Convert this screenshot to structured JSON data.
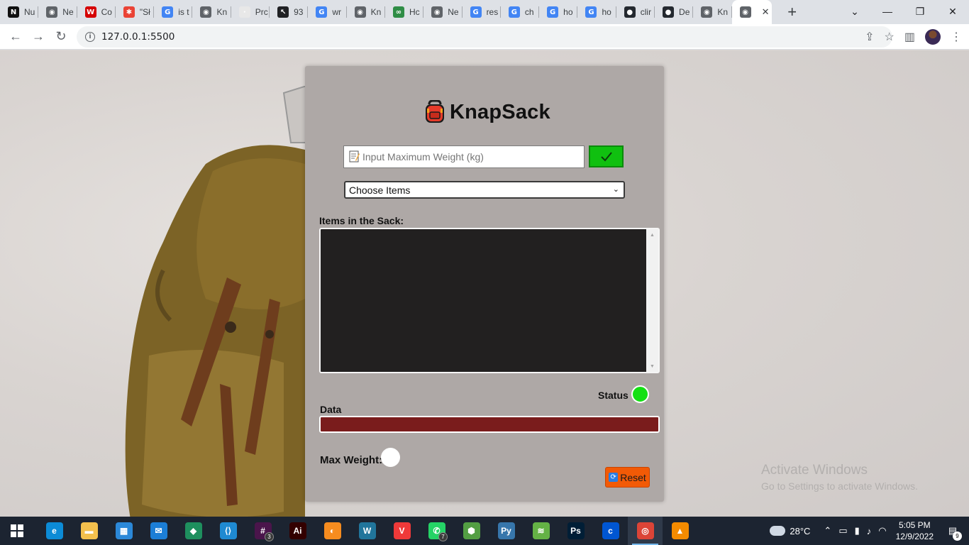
{
  "browser": {
    "tabs": [
      {
        "title": "Nu",
        "icon": "nu-favicon",
        "color": "#111111",
        "glyph": "N"
      },
      {
        "title": "Ne",
        "icon": "chromium-favicon",
        "color": "#5f6368",
        "glyph": "◉"
      },
      {
        "title": "Co",
        "icon": "w3-favicon",
        "color": "#d50000",
        "glyph": "W"
      },
      {
        "title": "\"Sł",
        "icon": "asterisk-favicon",
        "color": "#ea4335",
        "glyph": "✱"
      },
      {
        "title": "is t",
        "icon": "google-favicon",
        "color": "#4285f4",
        "glyph": "G"
      },
      {
        "title": "Kn",
        "icon": "globe-favicon",
        "color": "#5f6368",
        "glyph": "◉"
      },
      {
        "title": "Prc",
        "icon": "doc-favicon",
        "color": "#e8e8e8",
        "glyph": "·"
      },
      {
        "title": "93",
        "icon": "cursor-favicon",
        "color": "#202124",
        "glyph": "↖"
      },
      {
        "title": "wr",
        "icon": "google-favicon",
        "color": "#4285f4",
        "glyph": "G"
      },
      {
        "title": "Kn",
        "icon": "globe-favicon",
        "color": "#5f6368",
        "glyph": "◉"
      },
      {
        "title": "Hc",
        "icon": "gfg-favicon",
        "color": "#2f8d46",
        "glyph": "∞"
      },
      {
        "title": "Ne",
        "icon": "chromium-favicon",
        "color": "#5f6368",
        "glyph": "◉"
      },
      {
        "title": "res",
        "icon": "google-favicon",
        "color": "#4285f4",
        "glyph": "G"
      },
      {
        "title": "ch",
        "icon": "google-favicon",
        "color": "#4285f4",
        "glyph": "G"
      },
      {
        "title": "ho",
        "icon": "google-favicon",
        "color": "#4285f4",
        "glyph": "G"
      },
      {
        "title": "ho",
        "icon": "google-favicon",
        "color": "#4285f4",
        "glyph": "G"
      },
      {
        "title": "clir",
        "icon": "github-favicon",
        "color": "#24292f",
        "glyph": "●"
      },
      {
        "title": "De",
        "icon": "github-favicon",
        "color": "#24292f",
        "glyph": "●"
      },
      {
        "title": "Kn",
        "icon": "globe-favicon",
        "color": "#5f6368",
        "glyph": "◉"
      }
    ],
    "active_tab_icon": "globe-favicon",
    "url": "127.0.0.1:5500"
  },
  "app": {
    "title": "KnapSack",
    "weight_placeholder": "Input Maximum Weight (kg)",
    "select_label": "Choose Items",
    "sack_label": "Items in the Sack:",
    "status_label": "Status",
    "status_color": "#14e014",
    "data_label": "Data",
    "data_bar_color": "#7a1c1c",
    "max_weight_label": "Max Weight:",
    "reset_label": "Reset"
  },
  "watermark": {
    "line1": "Activate Windows",
    "line2": "Go to Settings to activate Windows."
  },
  "taskbar": {
    "apps": [
      {
        "name": "edge",
        "color": "#0c8bd6",
        "glyph": "e"
      },
      {
        "name": "file-explorer",
        "color": "#f3c04d",
        "glyph": "▬"
      },
      {
        "name": "microsoft-store",
        "color": "#2b88d8",
        "glyph": "▦"
      },
      {
        "name": "mail",
        "color": "#1c7ed6",
        "glyph": "✉"
      },
      {
        "name": "gitkraken",
        "color": "#1e8f5e",
        "glyph": "◆"
      },
      {
        "name": "vscode",
        "color": "#1f8ad2",
        "glyph": "⟨⟩"
      },
      {
        "name": "slack",
        "color": "#4a154b",
        "glyph": "#",
        "badge": "3"
      },
      {
        "name": "illustrator",
        "color": "#330000",
        "glyph": "Ai"
      },
      {
        "name": "fl-studio",
        "color": "#f68c1f",
        "glyph": "◐"
      },
      {
        "name": "wordpress",
        "color": "#21759b",
        "glyph": "W"
      },
      {
        "name": "vivaldi",
        "color": "#ef3939",
        "glyph": "V"
      },
      {
        "name": "whatsapp",
        "color": "#25d366",
        "glyph": "✆",
        "badge": "7"
      },
      {
        "name": "node-js",
        "color": "#539e43",
        "glyph": "⬢"
      },
      {
        "name": "python",
        "color": "#3776ab",
        "glyph": "Py"
      },
      {
        "name": "bluestacks",
        "color": "#64b245",
        "glyph": "≋"
      },
      {
        "name": "photoshop",
        "color": "#001e36",
        "glyph": "Ps"
      },
      {
        "name": "coursera",
        "color": "#0056d2",
        "glyph": "c"
      },
      {
        "name": "chrome",
        "color": "#db4437",
        "glyph": "◎",
        "active": true
      },
      {
        "name": "vlc",
        "color": "#f48b00",
        "glyph": "▲"
      }
    ],
    "temperature": "28°C",
    "time": "5:05 PM",
    "date": "12/9/2022",
    "notification_count": "9"
  }
}
